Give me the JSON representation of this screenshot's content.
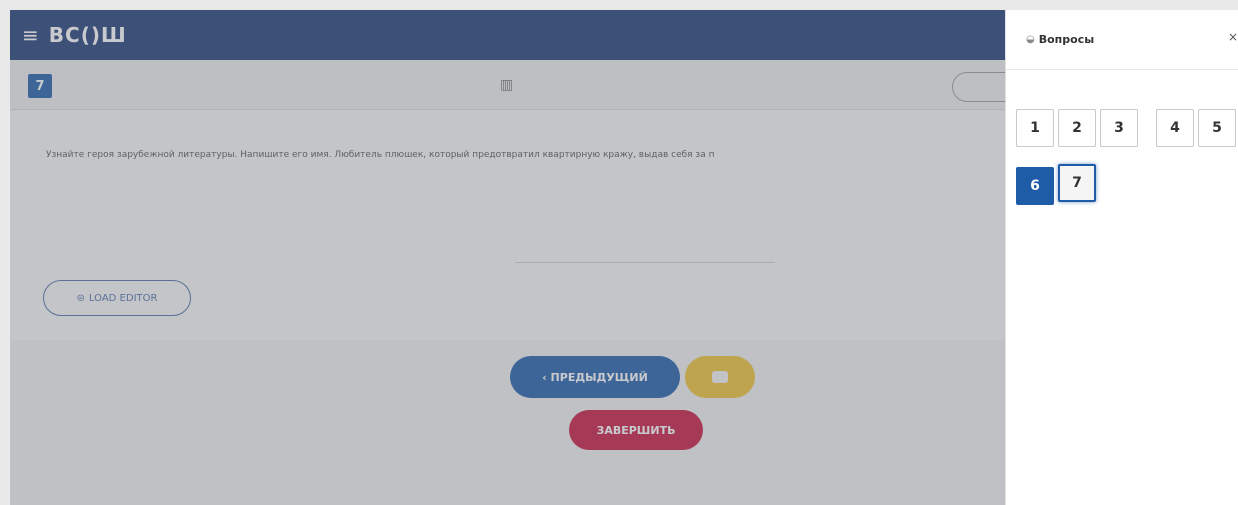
{
  "header": {
    "menu_icon": "hamburger-icon",
    "logo_text": "ВС()Ш"
  },
  "question_bar": {
    "number": "7",
    "center_icon": "grid-icon"
  },
  "question": {
    "text": "Узнайте героя зарубежной литературы. Напишите его имя. Любитель плюшек, который предотвратил квартирную кражу, выдав себя за п"
  },
  "editor": {
    "load_label": "LOAD EDITOR"
  },
  "footer": {
    "prev_label": "‹ ПРЕДЫДУЩИЙ",
    "finish_label": "ЗАВЕРШИТЬ"
  },
  "panel": {
    "title": "Вопросы",
    "icon": "questions-icon",
    "close": "×",
    "questions": [
      "1",
      "2",
      "3",
      "4",
      "5",
      "6",
      "7"
    ],
    "answered": "6",
    "current": "7"
  },
  "colors": {
    "header_bg": "#1f3b75",
    "accent_blue": "#1f5ca8",
    "accent_yellow": "#f0c233",
    "accent_red": "#c8183e"
  }
}
